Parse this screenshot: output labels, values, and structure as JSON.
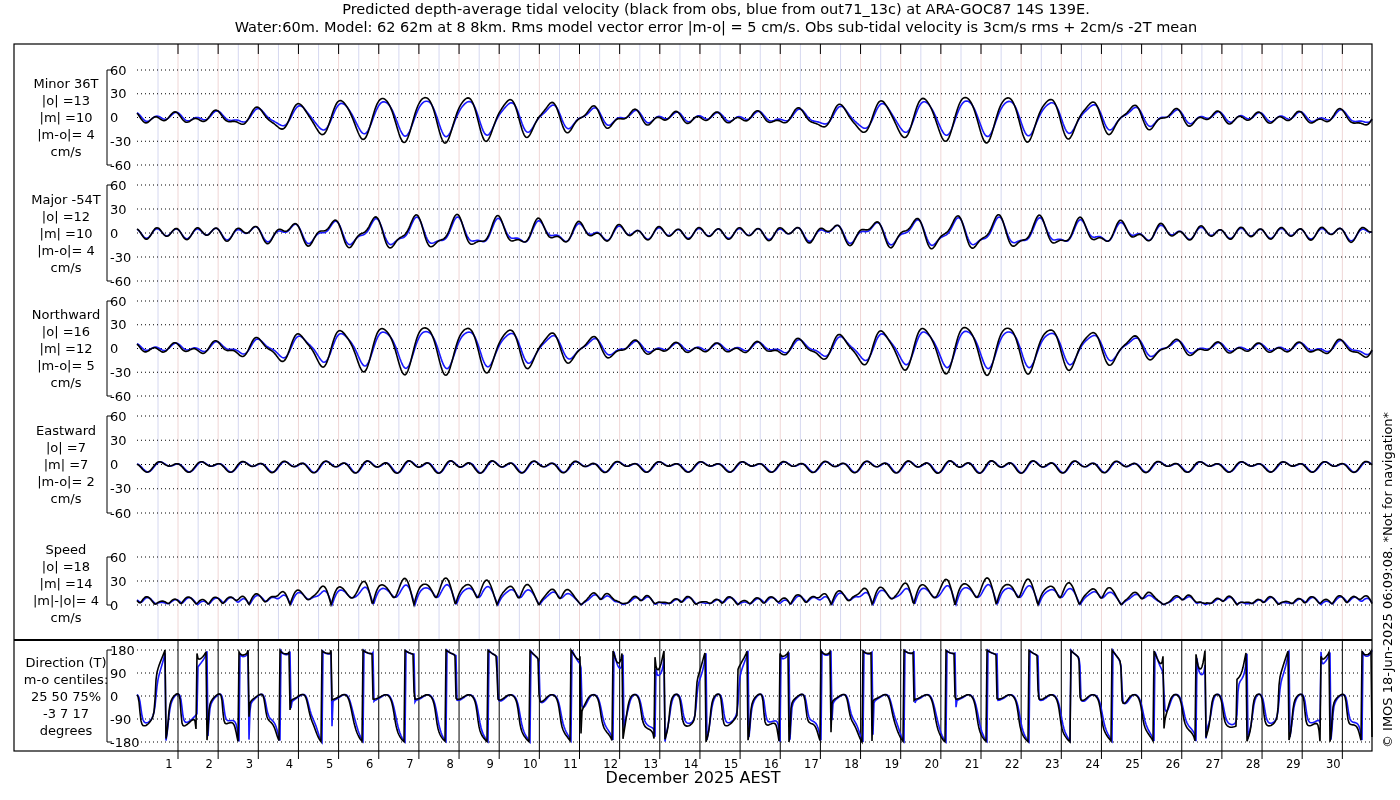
{
  "title_lines": [
    "Predicted depth-average tidal velocity (black from obs, blue from out71_13c) at ARA-GOC87 14S 139E.",
    "Water:60m. Model: 62 62m at 8 8km. Rms model vector error |m-o| = 5 cm/s. Obs sub-tidal velocity is 3cm/s rms + 2cm/s -2T mean"
  ],
  "panels": [
    {
      "kind": "minor",
      "label_lines": [
        "Minor 36T",
        "|o| =13",
        "|m| =10",
        "|m-o|= 4",
        "cm/s"
      ],
      "yticks": [
        "60",
        "30",
        "0",
        "-30",
        "-60"
      ]
    },
    {
      "kind": "major",
      "label_lines": [
        "Major -54T",
        "|o| =12",
        "|m| =10",
        "|m-o|= 4",
        "cm/s"
      ],
      "yticks": [
        "60",
        "30",
        "0",
        "-30",
        "-60"
      ]
    },
    {
      "kind": "north",
      "label_lines": [
        "Northward",
        "|o| =16",
        "|m| =12",
        "|m-o|= 5",
        "cm/s"
      ],
      "yticks": [
        "60",
        "30",
        "0",
        "-30",
        "-60"
      ]
    },
    {
      "kind": "east",
      "label_lines": [
        "Eastward",
        "|o| =7",
        "|m| =7",
        "|m-o|= 2",
        "cm/s"
      ],
      "yticks": [
        "60",
        "30",
        "0",
        "-30",
        "-60"
      ]
    },
    {
      "kind": "speed",
      "label_lines": [
        "Speed",
        "|o| =18",
        "|m| =14",
        "|m|-|o|= 4",
        "cm/s"
      ],
      "yticks": [
        "60",
        "30",
        "0"
      ]
    },
    {
      "kind": "direction",
      "label_lines": [
        "Direction (T)",
        "m-o centiles:",
        "25  50  75%",
        "-3   7  17",
        "degrees"
      ],
      "yticks": [
        "180",
        "90",
        "0",
        "-90",
        "-180"
      ]
    }
  ],
  "x_tick_labels": [
    "1",
    "2",
    "3",
    "4",
    "5",
    "6",
    "7",
    "8",
    "9",
    "10",
    "11",
    "12",
    "13",
    "14",
    "15",
    "16",
    "17",
    "18",
    "19",
    "20",
    "21",
    "22",
    "23",
    "24",
    "25",
    "26",
    "27",
    "28",
    "29",
    "30"
  ],
  "xlabel": "December 2025 AEST",
  "side_note": "© IMOS 18-Jun-2025 06:09:08. *Not for navigation*"
}
